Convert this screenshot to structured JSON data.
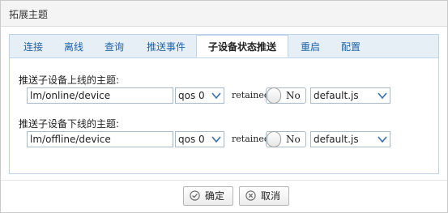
{
  "dialog": {
    "title": "拓展主题"
  },
  "tabs": [
    {
      "label": "连接",
      "active": false
    },
    {
      "label": "离线",
      "active": false
    },
    {
      "label": "查询",
      "active": false
    },
    {
      "label": "推送事件",
      "active": false
    },
    {
      "label": "子设备状态推送",
      "active": true
    },
    {
      "label": "重启",
      "active": false
    },
    {
      "label": "配置",
      "active": false
    }
  ],
  "form": {
    "online": {
      "label": "推送子设备上线的主题:",
      "topic": "lm/online/device",
      "qos": "qos 0",
      "retained_label": "retained:",
      "retained_state": "No",
      "script": "default.js"
    },
    "offline": {
      "label": "推送子设备下线的主题:",
      "topic": "lm/offline/device",
      "qos": "qos 0",
      "retained_label": "retained:",
      "retained_state": "No",
      "script": "default.js"
    }
  },
  "buttons": {
    "ok": "确定",
    "cancel": "取消"
  },
  "colors": {
    "tab_text": "#1f63a8",
    "tab_strip": "#e6eef6",
    "border": "#bcd3e8"
  }
}
